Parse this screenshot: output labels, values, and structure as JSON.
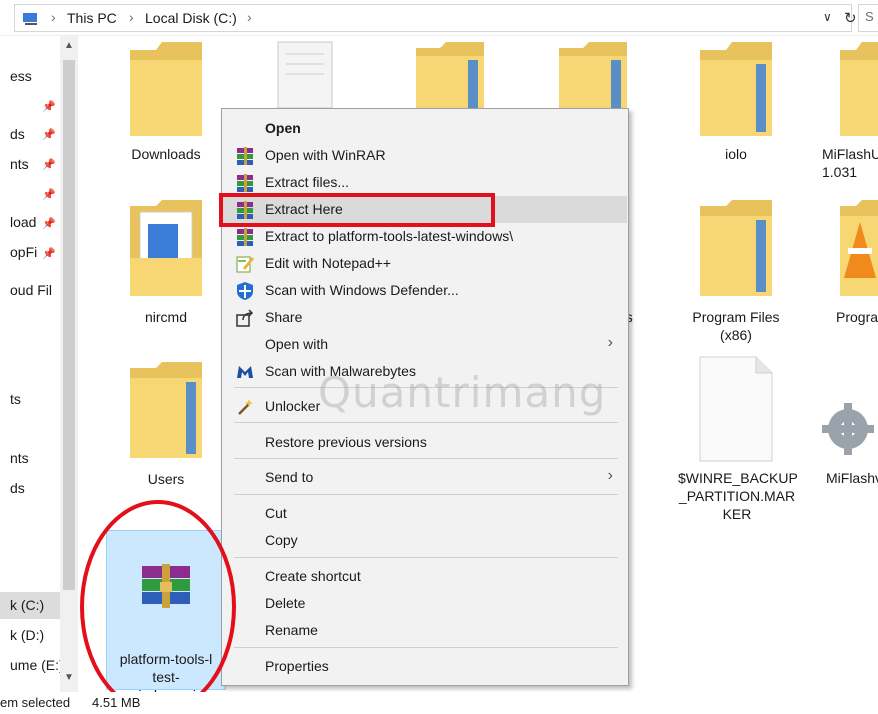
{
  "addressbar": {
    "crumbs": [
      "This PC",
      "Local Disk (C:)"
    ],
    "search_placeholder": "S"
  },
  "nav": {
    "items": [
      "ess",
      "ds",
      "nts",
      "load",
      "opFi",
      "oud Fil",
      "ts",
      "nts",
      "ds",
      "k (C:)",
      "k (D:)",
      "ume (E:)"
    ]
  },
  "content": {
    "items": [
      {
        "label": "Downloads",
        "icon": "folder-icon"
      },
      {
        "label": "",
        "icon": "document-folder-icon"
      },
      {
        "label": "",
        "icon": "folder-icon"
      },
      {
        "label": "",
        "icon": "folder-icon"
      },
      {
        "label": "iolo",
        "icon": "folder-icon"
      },
      {
        "label": "MiFlashU\n1.031",
        "icon": "folder-icon"
      },
      {
        "label": "nircmd",
        "icon": "document-folder-icon"
      },
      {
        "label": "es",
        "icon": "folder-icon"
      },
      {
        "label": "Program Files\n(x86)",
        "icon": "folder-icon"
      },
      {
        "label": "Progra",
        "icon": "vlc-icon"
      },
      {
        "label": "Users",
        "icon": "folder-icon"
      },
      {
        "label": "$WINRE_BACKUP\n_PARTITION.MAR\nKER",
        "icon": "blank-file-icon"
      },
      {
        "label": "MiFlashv",
        "icon": "gear-icon"
      },
      {
        "label": "platform-tools-l\ntest-windows.zip",
        "icon": "winrar-archive-icon"
      }
    ]
  },
  "context_menu": {
    "items": [
      {
        "label": "Open",
        "icon": ""
      },
      {
        "label": "Open with WinRAR",
        "icon": "winrar-icon"
      },
      {
        "label": "Extract files...",
        "icon": "winrar-icon"
      },
      {
        "label": "Extract Here",
        "icon": "winrar-icon"
      },
      {
        "label": "Extract to platform-tools-latest-windows\\",
        "icon": "winrar-icon"
      },
      {
        "label": "Edit with Notepad++",
        "icon": "notepad-plus-icon"
      },
      {
        "label": "Scan with Windows Defender...",
        "icon": "defender-icon"
      },
      {
        "label": "Share",
        "icon": "share-icon"
      },
      {
        "label": "Open with",
        "icon": ""
      },
      {
        "label": "Scan with Malwarebytes",
        "icon": "malwarebytes-icon"
      },
      {
        "label": "Unlocker",
        "icon": "unlocker-wand-icon"
      },
      {
        "label": "Restore previous versions",
        "icon": ""
      },
      {
        "label": "Send to",
        "icon": ""
      },
      {
        "label": "Cut",
        "icon": ""
      },
      {
        "label": "Copy",
        "icon": ""
      },
      {
        "label": "Create shortcut",
        "icon": ""
      },
      {
        "label": "Delete",
        "icon": ""
      },
      {
        "label": "Rename",
        "icon": ""
      },
      {
        "label": "Properties",
        "icon": ""
      }
    ]
  },
  "status": {
    "selected": "em selected",
    "size": "4.51 MB"
  },
  "watermark": "Quantrimang",
  "colors": {
    "highlight_red": "#e3101b",
    "selection_blue": "#cce8ff",
    "menu_bg": "#f2f2f2",
    "folder_yellow": "#f7d774"
  }
}
